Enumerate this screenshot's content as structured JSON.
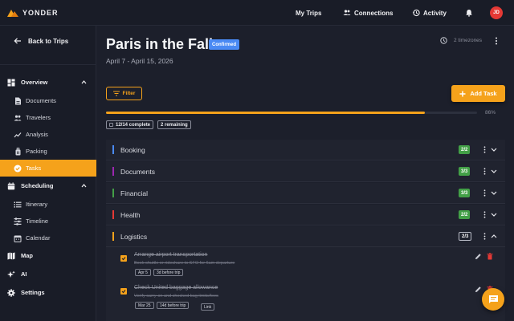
{
  "app": {
    "brand": "YONDER",
    "accent": "#f5a21b"
  },
  "topnav": {
    "items": [
      {
        "label": "My Trips",
        "icon": "none"
      },
      {
        "label": "Connections",
        "icon": "people-icon"
      },
      {
        "label": "Activity",
        "icon": "history-icon"
      }
    ],
    "avatar_initials": "JD"
  },
  "sidebar": {
    "back_label": "Back to Trips",
    "overview": {
      "label": "Overview",
      "items": [
        {
          "label": "Documents",
          "icon": "document-icon"
        },
        {
          "label": "Travelers",
          "icon": "people-icon"
        },
        {
          "label": "Analysis",
          "icon": "chart-icon"
        },
        {
          "label": "Packing",
          "icon": "luggage-icon"
        },
        {
          "label": "Tasks",
          "icon": "check-circle-icon",
          "active": true
        }
      ]
    },
    "scheduling": {
      "label": "Scheduling",
      "items": [
        {
          "label": "Itinerary",
          "icon": "list-icon"
        },
        {
          "label": "Timeline",
          "icon": "timeline-icon"
        },
        {
          "label": "Calendar",
          "icon": "calendar-icon"
        }
      ]
    },
    "bottom_items": [
      {
        "label": "Map",
        "icon": "map-icon"
      },
      {
        "label": "AI",
        "icon": "sparkle-icon"
      },
      {
        "label": "Settings",
        "icon": "gear-icon"
      }
    ]
  },
  "trip": {
    "title": "Paris in the Fall",
    "status": "Confirmed",
    "dates": "April 7 - April 15, 2026",
    "timezones": "2 timezones"
  },
  "toolbar": {
    "filter_label": "Filter",
    "add_task_label": "Add Task"
  },
  "progress": {
    "percent": 86,
    "percent_label": "86%",
    "complete_label": "12/14 complete",
    "remaining_label": "2 remaining"
  },
  "categories": [
    {
      "name": "Booking",
      "color": "#4a8af4",
      "count": "2/2",
      "complete": true,
      "expanded": false
    },
    {
      "name": "Documents",
      "color": "#9c27b0",
      "count": "3/3",
      "complete": true,
      "expanded": false
    },
    {
      "name": "Financial",
      "color": "#43a047",
      "count": "3/3",
      "complete": true,
      "expanded": false
    },
    {
      "name": "Health",
      "color": "#e53935",
      "count": "2/2",
      "complete": true,
      "expanded": false
    },
    {
      "name": "Logistics",
      "color": "#f5a21b",
      "count": "2/3",
      "complete": false,
      "expanded": true
    }
  ],
  "tasks": [
    {
      "title": "Arrange airport transportation",
      "description": "Book shuttle or rideshare to SFO for 6am departure",
      "tags": [
        "Apr 5",
        "3d before trip"
      ],
      "done": true
    },
    {
      "title": "Check United baggage allowance",
      "description": "Verify carry-on and checked bag limits/fees",
      "tags": [
        "Mar 25",
        "14d before trip",
        "Link"
      ],
      "done": true
    }
  ]
}
